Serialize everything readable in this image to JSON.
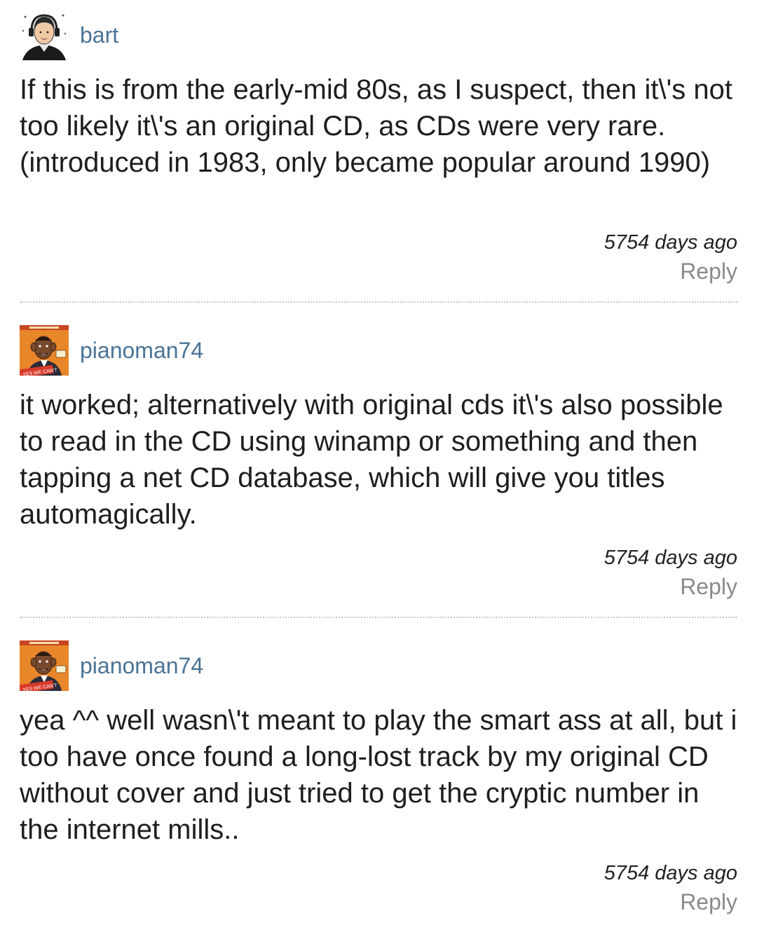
{
  "comments": [
    {
      "username": "bart",
      "avatar": "avatar-headphones-man",
      "text": "If this is from the early-mid 80s, as I suspect, then it\\'s not too likely it\\'s an original CD, as CDs were very rare. (introduced in 1983, only became popular around 1990)",
      "timestamp": "5754 days ago",
      "reply_label": "Reply"
    },
    {
      "username": "pianoman74",
      "avatar": "avatar-mad-magazine-cover",
      "avatar_caption": "YES WE CAN'T",
      "text": "it worked; alternatively with original cds it\\'s also possible to read in the CD using winamp or something and then tapping a net CD database, which will give you titles automagically.",
      "timestamp": "5754 days ago",
      "reply_label": "Reply"
    },
    {
      "username": "pianoman74",
      "avatar": "avatar-mad-magazine-cover",
      "avatar_caption": "YES WE CAN'T",
      "text": "yea ^^ well wasn\\'t meant to play the smart ass at all, but i too have once found a long-lost track by my original CD without cover and just tried to get the cryptic number in the internet mills..",
      "timestamp": "5754 days ago",
      "reply_label": "Reply"
    }
  ],
  "colors": {
    "username": "#4a7396",
    "reply": "#8a8a8a",
    "body_text": "#1e1e1e",
    "divider": "#c8c8c8"
  }
}
